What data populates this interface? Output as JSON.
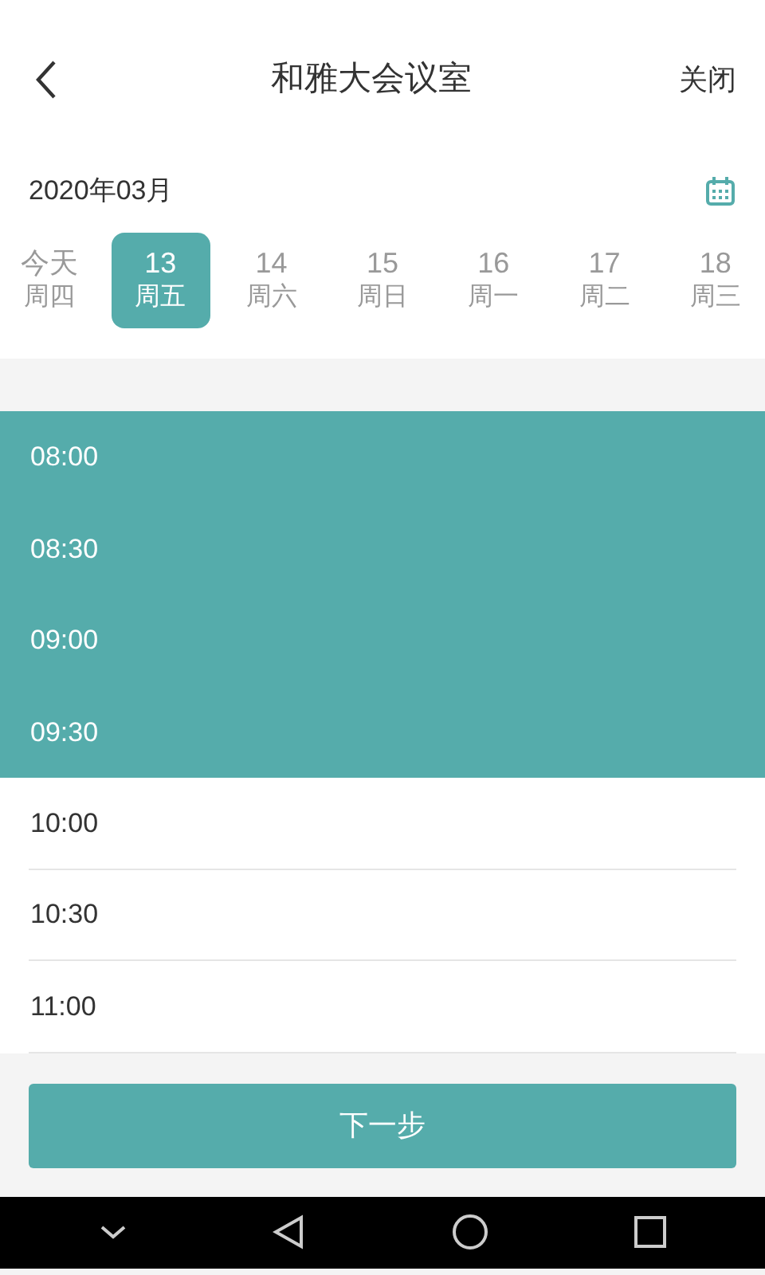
{
  "header": {
    "title": "和雅大会议室",
    "close": "关闭"
  },
  "month": "2020年03月",
  "days": [
    {
      "day": "今天",
      "weekday": "周四",
      "selected": false
    },
    {
      "day": "13",
      "weekday": "周五",
      "selected": true
    },
    {
      "day": "14",
      "weekday": "周六",
      "selected": false
    },
    {
      "day": "15",
      "weekday": "周日",
      "selected": false
    },
    {
      "day": "16",
      "weekday": "周一",
      "selected": false
    },
    {
      "day": "17",
      "weekday": "周二",
      "selected": false
    },
    {
      "day": "18",
      "weekday": "周三",
      "selected": false
    }
  ],
  "slots": [
    {
      "time": "08:00",
      "selected": true
    },
    {
      "time": "08:30",
      "selected": true
    },
    {
      "time": "09:00",
      "selected": true
    },
    {
      "time": "09:30",
      "selected": true
    },
    {
      "time": "10:00",
      "selected": false
    },
    {
      "time": "10:30",
      "selected": false
    },
    {
      "time": "11:00",
      "selected": false
    }
  ],
  "next_button": "下一步"
}
